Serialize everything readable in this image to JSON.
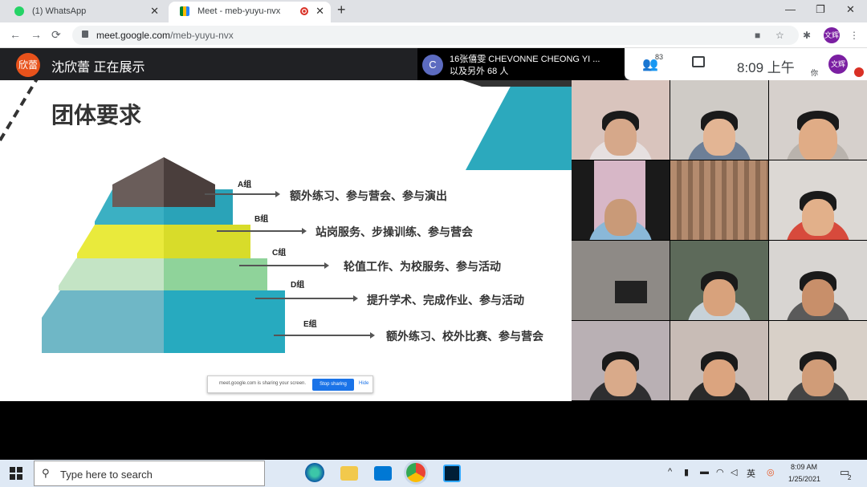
{
  "browser": {
    "tabs": [
      {
        "title": "(1) WhatsApp",
        "icon": "whatsapp-icon"
      },
      {
        "title": "Meet - meb-yuyu-nvx",
        "icon": "google-meet-icon"
      }
    ],
    "url_host": "meet.google.com",
    "url_path": "/meb-yuyu-nvx",
    "profile_initials": "文辉"
  },
  "meet": {
    "presenter_avatar": "欣蕾",
    "presenter_text": "沈欣蕾 正在展示",
    "participant_popup": {
      "avatar_letter": "C",
      "name": "16张僖雯 CHEVONNE CHEONG YI ...",
      "more": "以及另外 68 人"
    },
    "people_count": "83",
    "time": "8:09 上午",
    "you_label": "你",
    "you_avatar": "文辉"
  },
  "slide": {
    "title": "团体要求",
    "tiers": [
      {
        "label": "A组",
        "desc": "额外练习、参与营会、参与演出",
        "color": "#5a4d4a"
      },
      {
        "label": "B组",
        "desc": "站岗服务、步操训练、参与营会",
        "color": "#2aa3b8"
      },
      {
        "label": "C组",
        "desc": "轮值工作、为校服务、参与活动",
        "color": "#d8dc2a"
      },
      {
        "label": "D组",
        "desc": "提升学术、完成作业、参与活动",
        "color": "#8fd39a"
      },
      {
        "label": "E组",
        "desc": "额外练习、校外比赛、参与营会",
        "color": "#27aabf"
      }
    ],
    "share_bar": {
      "message": "meet.google.com is sharing your screen.",
      "stop_label": "Stop sharing",
      "hide_label": "Hide"
    }
  },
  "taskbar": {
    "search_placeholder": "Type here to search",
    "time": "8:09 AM",
    "date": "1/25/2021",
    "notification_count": "2"
  }
}
